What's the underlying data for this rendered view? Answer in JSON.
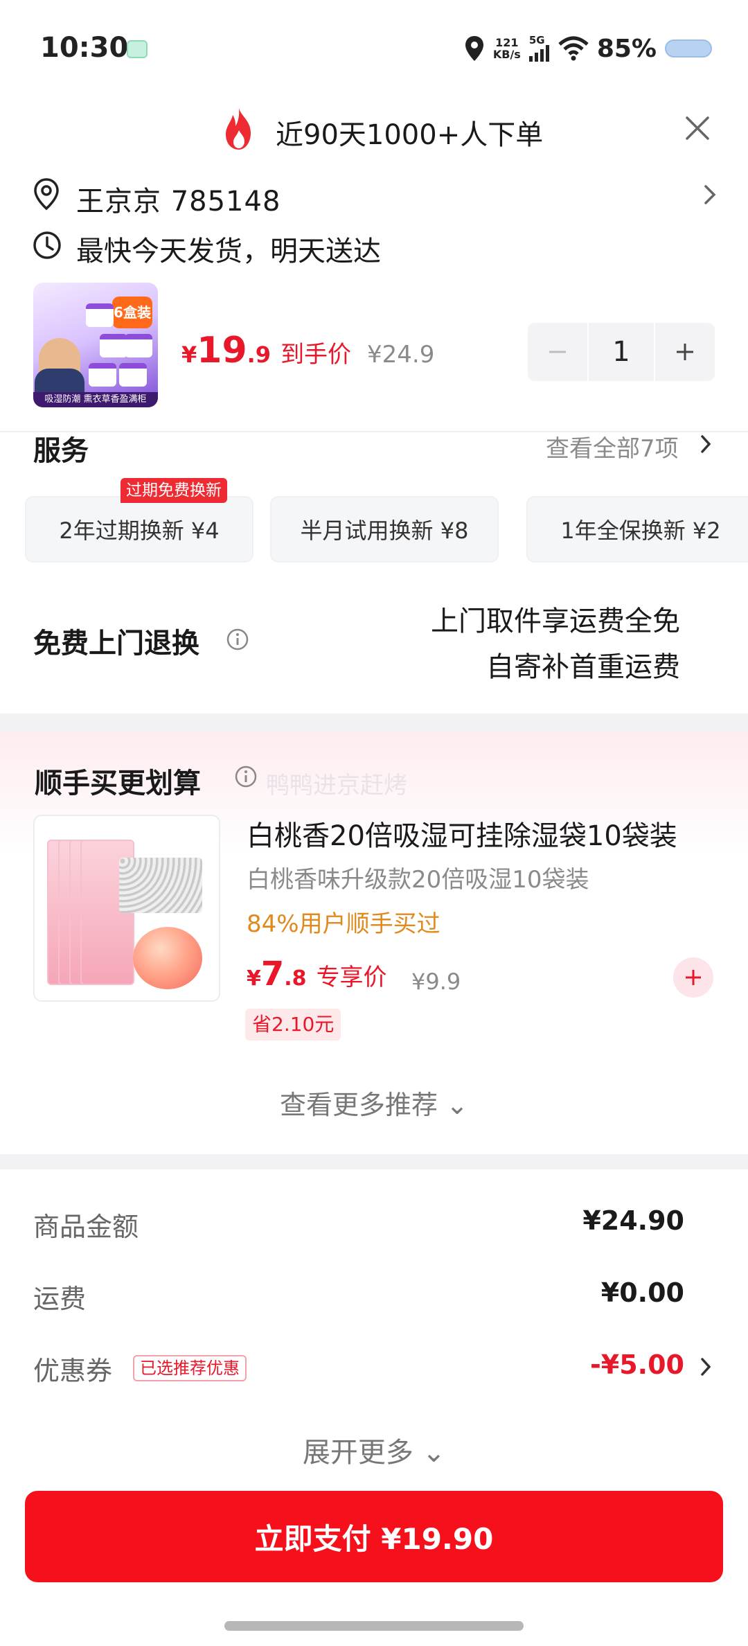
{
  "status_bar": {
    "time": "10:30",
    "net_speed_value": "121",
    "net_speed_unit": "KB/s",
    "network": "5G",
    "battery": "85%"
  },
  "header": {
    "title": "近90天1000+人下单",
    "icon": "fire-icon"
  },
  "address": {
    "name_code": "王京京  785148",
    "shipping": "最快今天发货，明天送达"
  },
  "product": {
    "currency": "¥",
    "price_int": "19",
    "price_dec": ".9",
    "price_label": "到手价",
    "original_price": "¥24.9",
    "quantity": "1",
    "thumb_badge": "6盒装",
    "thumb_banner": "吸湿防潮 熏衣草香盈满柜"
  },
  "services": {
    "title": "服务",
    "view_all": "查看全部7项",
    "badge": "过期免费换新",
    "cards": [
      "2年过期换新  ¥4",
      "半月试用换新  ¥8",
      "1年全保换新  ¥2"
    ]
  },
  "returns": {
    "title": "免费上门退换",
    "line1": "上门取件享运费全免",
    "line2": "自寄补首重运费"
  },
  "recommend": {
    "title": "顺手买更划算",
    "watermark": "鸭鸭进京赶烤",
    "item_name": "白桃香20倍吸湿可挂除湿袋10袋装",
    "item_sub": "白桃香味升级款20倍吸湿10袋装",
    "item_pct": "84%用户顺手买过",
    "currency": "¥",
    "price_int": "7",
    "price_dec": ".8",
    "price_label": "专享价",
    "original_price": "¥9.9",
    "save": "省2.10元",
    "more": "查看更多推荐 ⌄"
  },
  "summary": {
    "goods_label": "商品金额",
    "goods_value": "¥24.90",
    "freight_label": "运费",
    "freight_value": "¥0.00",
    "coupon_label": "优惠券",
    "coupon_tag": "已选推荐优惠",
    "coupon_value": "-¥5.00",
    "expand": "展开更多 ⌄"
  },
  "pay_button": "立即支付 ¥19.90",
  "colors": {
    "accent_red": "#f5101c",
    "price_red": "#e8172a",
    "highlight_orange": "#e08a1e"
  }
}
